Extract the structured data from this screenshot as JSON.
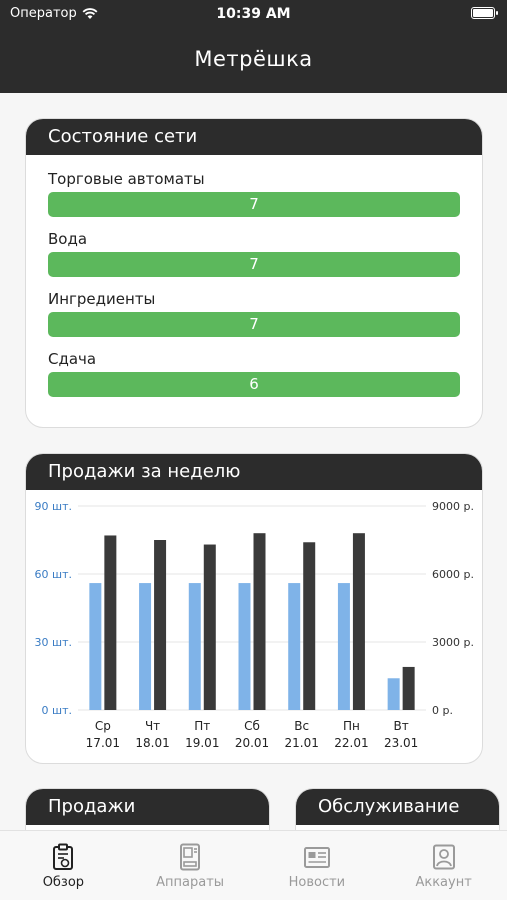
{
  "status_bar": {
    "carrier": "Оператор",
    "time": "10:39 AM"
  },
  "nav": {
    "title": "Метрёшка"
  },
  "network_card": {
    "title": "Состояние сети",
    "items": [
      {
        "label": "Торговые автоматы",
        "value": "7"
      },
      {
        "label": "Вода",
        "value": "7"
      },
      {
        "label": "Ингредиенты",
        "value": "7"
      },
      {
        "label": "Сдача",
        "value": "6"
      }
    ],
    "bar_color": "#5cb85c"
  },
  "sales_week_card": {
    "title": "Продажи за неделю"
  },
  "chart_data": {
    "type": "bar",
    "categories": [
      {
        "day": "Ср",
        "date": "17.01"
      },
      {
        "day": "Чт",
        "date": "18.01"
      },
      {
        "day": "Пт",
        "date": "19.01"
      },
      {
        "day": "Сб",
        "date": "20.01"
      },
      {
        "day": "Вс",
        "date": "21.01"
      },
      {
        "day": "Пн",
        "date": "22.01"
      },
      {
        "day": "Вт",
        "date": "23.01"
      }
    ],
    "series": [
      {
        "values": [
          56,
          56,
          56,
          56,
          56,
          56,
          14
        ],
        "color": "#7fb3e8",
        "axis": "left"
      },
      {
        "values": [
          7700,
          7500,
          7300,
          7800,
          7400,
          7800,
          1900
        ],
        "color": "#3a3a3a",
        "axis": "right"
      }
    ],
    "left_axis": {
      "ticks": [
        "0 шт.",
        "30 шт.",
        "60 шт.",
        "90 шт."
      ],
      "range": [
        0,
        90
      ],
      "color": "#3a7cc4"
    },
    "right_axis": {
      "ticks": [
        "0 р.",
        "3000 р.",
        "6000 р.",
        "9000 р."
      ],
      "range": [
        0,
        9000
      ],
      "color": "#333333"
    },
    "grid": true
  },
  "sales_card": {
    "title": "Продажи"
  },
  "service_card": {
    "title": "Обслуживание"
  },
  "tabs": [
    {
      "label": "Обзор",
      "icon": "overview-icon",
      "active": true
    },
    {
      "label": "Аппараты",
      "icon": "machines-icon",
      "active": false
    },
    {
      "label": "Новости",
      "icon": "news-icon",
      "active": false
    },
    {
      "label": "Аккаунт",
      "icon": "account-icon",
      "active": false
    }
  ]
}
